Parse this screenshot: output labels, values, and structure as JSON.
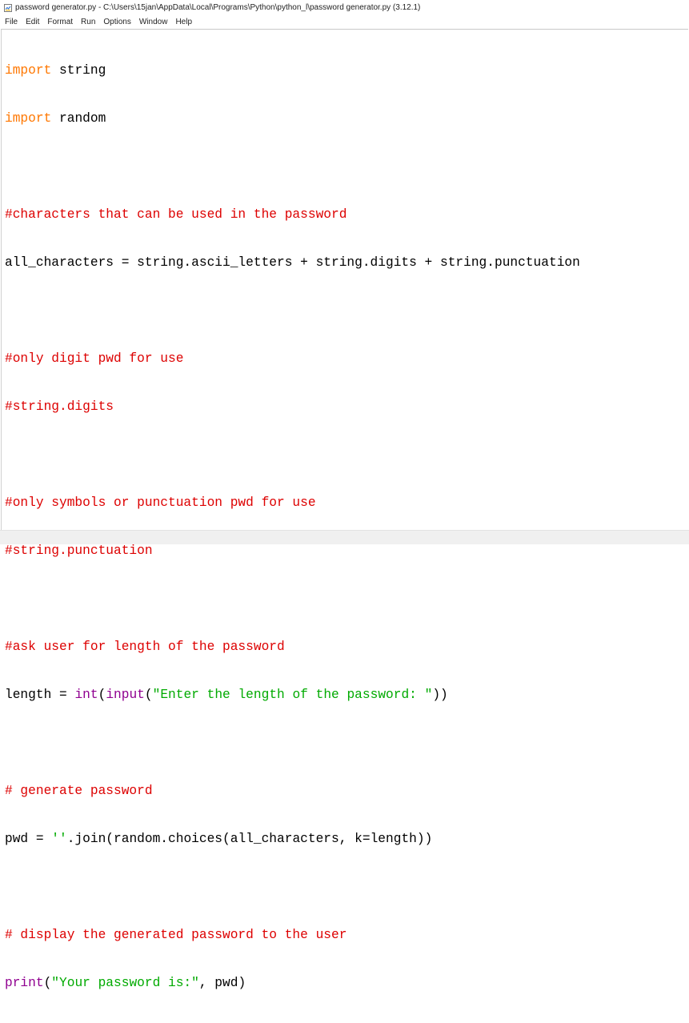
{
  "window": {
    "title": "password generator.py - C:\\Users\\15jan\\AppData\\Local\\Programs\\Python\\python_l\\password generator.py (3.12.1)"
  },
  "menu": [
    "File",
    "Edit",
    "Format",
    "Run",
    "Options",
    "Window",
    "Help"
  ],
  "code": {
    "l1_kw": "import",
    "l1_rest": " string",
    "l2_kw": "import",
    "l2_rest": " random",
    "l4_cm": "#characters that can be used in the password",
    "l5": "all_characters = string.ascii_letters + string.digits + string.punctuation",
    "l7_cm": "#only digit pwd for use",
    "l8_cm": "#string.digits",
    "l10_cm": "#only symbols or punctuation pwd for use",
    "l11_cm": "#string.punctuation",
    "l13_cm": "#ask user for length of the password",
    "l14_a": "length = ",
    "l14_int": "int",
    "l14_b": "(",
    "l14_input": "input",
    "l14_c": "(",
    "l14_str": "\"Enter the length of the password: \"",
    "l14_d": "))",
    "l16_cm": "# generate password",
    "l17_a": "pwd = ",
    "l17_str": "''",
    "l17_b": ".join(random.choices(all_characters, k=length))",
    "l19_cm": "# display the generated password to the user",
    "l20_print": "print",
    "l20_a": "(",
    "l20_str": "\"Your password is:\"",
    "l20_b": ", pwd)"
  }
}
